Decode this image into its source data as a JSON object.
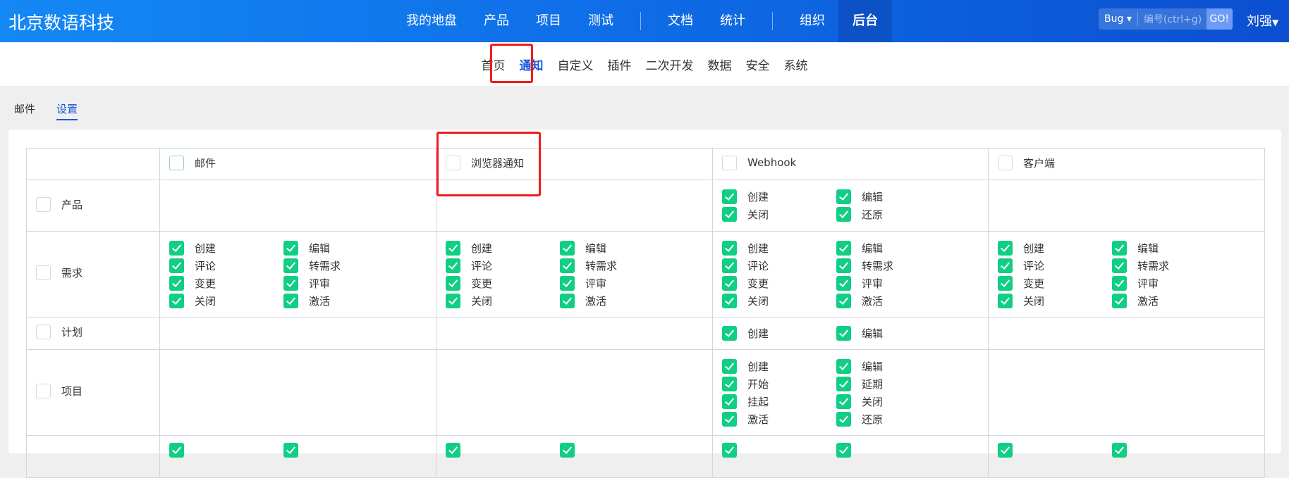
{
  "header": {
    "logo": "北京数语科技",
    "nav": [
      "我的地盘",
      "产品",
      "项目",
      "测试",
      "文档",
      "统计",
      "组织",
      "后台"
    ],
    "active": "后台",
    "search_type": "Bug",
    "search_placeholder": "编号(ctrl+g)",
    "go": "GO!",
    "user": "刘强"
  },
  "subnav": {
    "items": [
      "首页",
      "通知",
      "自定义",
      "插件",
      "二次开发",
      "数据",
      "安全",
      "系统"
    ],
    "active": "通知"
  },
  "tabs": {
    "items": [
      "邮件",
      "设置"
    ],
    "active": "设置"
  },
  "colors": {
    "accent": "#1a5ad8",
    "check": "#10cf85",
    "highlight": "#f01c1c"
  },
  "table": {
    "columns": [
      "邮件",
      "浏览器通知",
      "Webhook",
      "客户端"
    ],
    "rows": [
      {
        "name": "产品",
        "cells": [
          [],
          [],
          [
            "创建",
            "编辑",
            "关闭",
            "还原"
          ],
          []
        ]
      },
      {
        "name": "需求",
        "cells": [
          [
            "创建",
            "编辑",
            "评论",
            "转需求",
            "变更",
            "评审",
            "关闭",
            "激活"
          ],
          [
            "创建",
            "编辑",
            "评论",
            "转需求",
            "变更",
            "评审",
            "关闭",
            "激活"
          ],
          [
            "创建",
            "编辑",
            "评论",
            "转需求",
            "变更",
            "评审",
            "关闭",
            "激活"
          ],
          [
            "创建",
            "编辑",
            "评论",
            "转需求",
            "变更",
            "评审",
            "关闭",
            "激活"
          ]
        ]
      },
      {
        "name": "计划",
        "cells": [
          [],
          [],
          [
            "创建",
            "编辑"
          ],
          []
        ]
      },
      {
        "name": "项目",
        "cells": [
          [],
          [],
          [
            "创建",
            "编辑",
            "开始",
            "延期",
            "挂起",
            "关闭",
            "激活",
            "还原"
          ],
          []
        ]
      }
    ]
  }
}
